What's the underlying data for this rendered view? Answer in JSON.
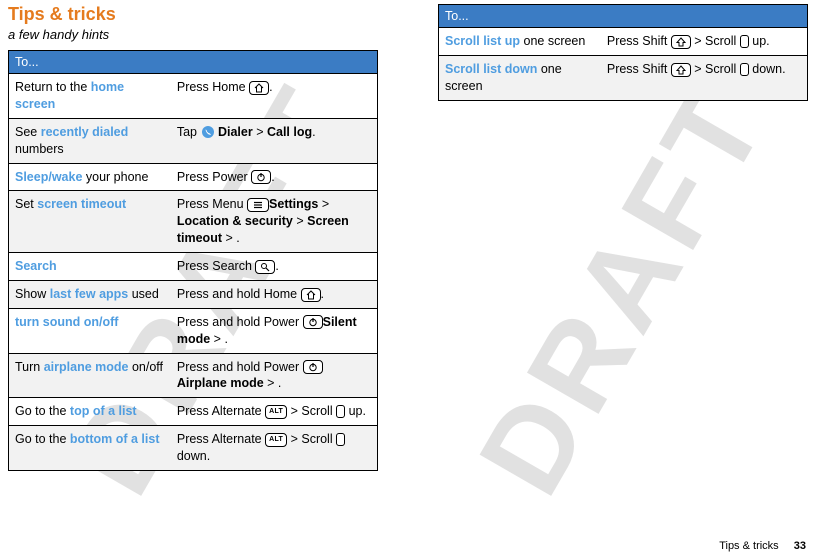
{
  "header": {
    "title": "Tips & tricks",
    "subtitle": "a few handy hints"
  },
  "watermark": "DRAFT",
  "table_header": "To...",
  "key_labels": {
    "alt": "ALT"
  },
  "rows_left": [
    {
      "task_pre": "Return to the ",
      "task_hl": "home screen",
      "task_post": "",
      "act_pre": "Press Home ",
      "icon": "home",
      "act_post": "."
    },
    {
      "task_pre": "See ",
      "task_hl": "recently dialed",
      "task_post": " numbers",
      "act_pre": "Tap ",
      "icon": "dialer",
      "act_mid": " ",
      "bold1": "Dialer",
      "sep1": " > ",
      "bold2": "Call log",
      "act_post": "."
    },
    {
      "task_hl": "Sleep/wake",
      "task_post": " your phone",
      "act_pre": "Press Power ",
      "icon": "power",
      "act_post": "."
    },
    {
      "task_pre": "Set ",
      "task_hl": "screen timeout",
      "act_pre": "Press Menu ",
      "icon": "menu",
      "sep1": " > ",
      "bold1": "Settings",
      "sep2": " > ",
      "bold2": "Location & security",
      "sep3": " > ",
      "bold3": "Screen timeout",
      "act_post": "."
    },
    {
      "task_hl": "Search",
      "act_pre": "Press Search ",
      "icon": "search",
      "act_post": "."
    },
    {
      "task_pre": "Show ",
      "task_hl": "last few apps",
      "task_post": " used",
      "act_pre": "Press and hold Home ",
      "icon": "home",
      "act_post": "."
    },
    {
      "task_hl": "turn sound on/off",
      "act_pre": "Press and hold Power ",
      "icon": "power",
      "sep1": " > ",
      "bold1": "Silent mode",
      "act_post": "."
    },
    {
      "task_pre": "Turn ",
      "task_hl": "airplane mode",
      "task_post": " on/off",
      "act_pre": "Press and hold Power ",
      "icon": "power",
      "sep1": " > ",
      "bold1": "Airplane mode",
      "act_post": "."
    },
    {
      "task_pre": "Go to the ",
      "task_hl": "top of a list",
      "act_pre": "Press Alternate ",
      "icon": "alt",
      "act_mid": " > Scroll ",
      "icon2": "scroll",
      "act_post": " up."
    },
    {
      "task_pre": "Go to the ",
      "task_hl": "bottom of a list",
      "act_pre": "Press Alternate ",
      "icon": "alt",
      "act_mid": " > Scroll ",
      "icon2": "scroll",
      "act_post": " down."
    }
  ],
  "rows_right": [
    {
      "task_hl": "Scroll list up",
      "task_post": " one screen",
      "act_pre": "Press Shift ",
      "icon": "shift",
      "act_mid": " > Scroll ",
      "icon2": "scroll",
      "act_post": " up."
    },
    {
      "task_hl": "Scroll list down",
      "task_post": " one screen",
      "act_pre": "Press Shift ",
      "icon": "shift",
      "act_mid": " > Scroll ",
      "icon2": "scroll",
      "act_post": " down."
    }
  ],
  "footer": {
    "section": "Tips & tricks",
    "page": "33"
  }
}
